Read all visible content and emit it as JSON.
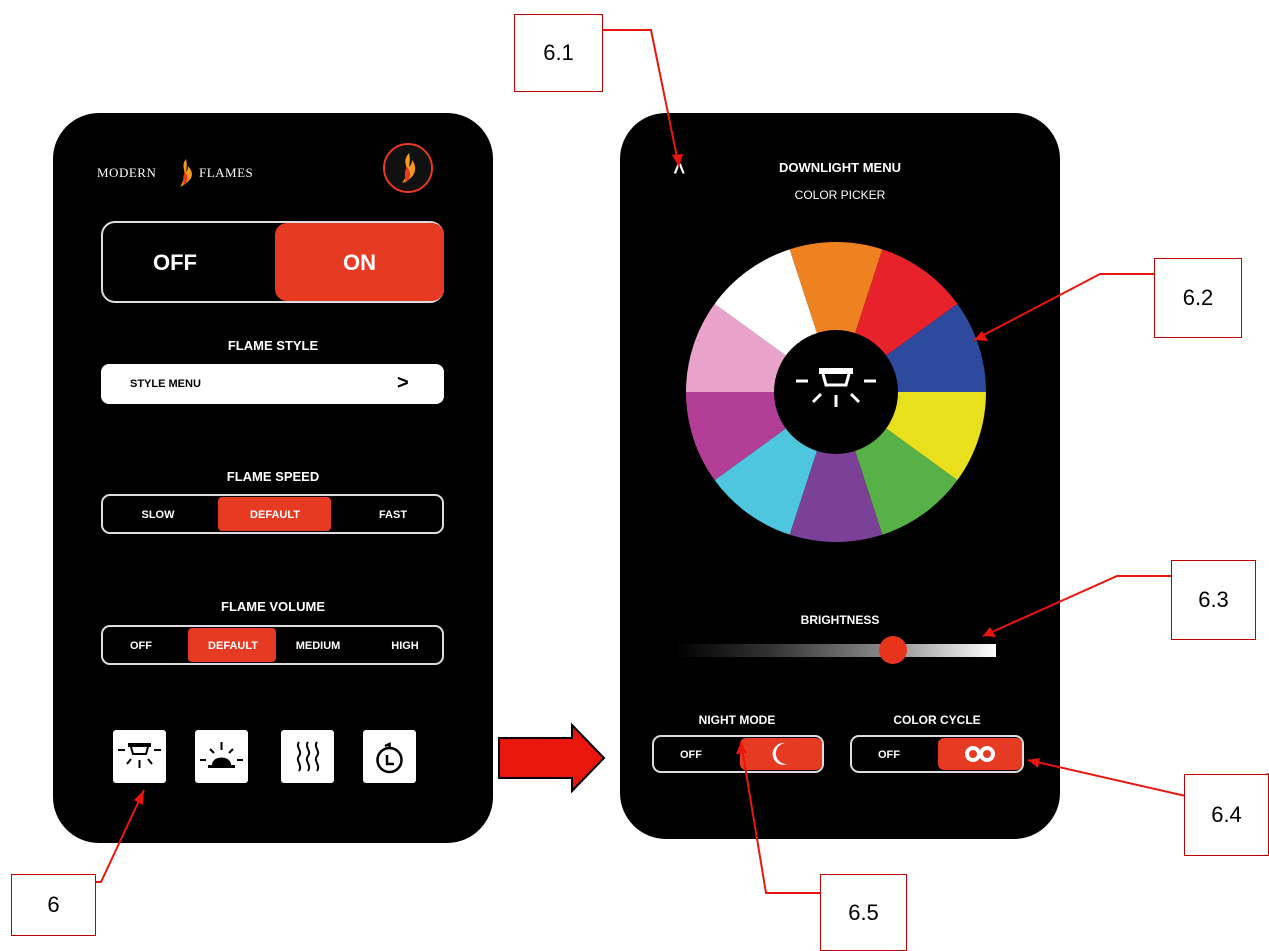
{
  "left_screen": {
    "brand": {
      "left": "MODERN",
      "right": "FLAMES"
    },
    "power": {
      "off_label": "OFF",
      "on_label": "ON",
      "selected": "ON"
    },
    "flame_style": {
      "heading": "FLAME STYLE",
      "menu_label": "STYLE MENU",
      "menu_arrow": ">"
    },
    "flame_speed": {
      "heading": "FLAME SPEED",
      "options": [
        "SLOW",
        "DEFAULT",
        "FAST"
      ],
      "selected": "DEFAULT"
    },
    "flame_volume": {
      "heading": "FLAME VOLUME",
      "options": [
        "OFF",
        "DEFAULT",
        "MEDIUM",
        "HIGH"
      ],
      "selected": "DEFAULT"
    },
    "bottom_icons": [
      "downlight-icon",
      "uplight-icon",
      "heat-icon",
      "timer-icon"
    ]
  },
  "right_screen": {
    "back_label": "<",
    "title": "DOWNLIGHT MENU",
    "subtitle": "COLOR PICKER",
    "color_wheel": [
      "#ef8220",
      "#e8222b",
      "#2e4a9e",
      "#e8e01c",
      "#58b146",
      "#7b4197",
      "#4ec6de",
      "#b33e98",
      "#e9a2c9",
      "#ffffff"
    ],
    "brightness": {
      "label": "BRIGHTNESS",
      "value": 0.68
    },
    "night_mode": {
      "label": "NIGHT MODE",
      "off_label": "OFF"
    },
    "color_cycle": {
      "label": "COLOR CYCLE",
      "off_label": "OFF"
    }
  },
  "callouts": {
    "c6": "6",
    "c61": "6.1",
    "c62": "6.2",
    "c63": "6.3",
    "c64": "6.4",
    "c65": "6.5"
  },
  "colors": {
    "accent": "#e63a22",
    "callout_line": "#e8160c",
    "screen_bg": "#000000"
  }
}
